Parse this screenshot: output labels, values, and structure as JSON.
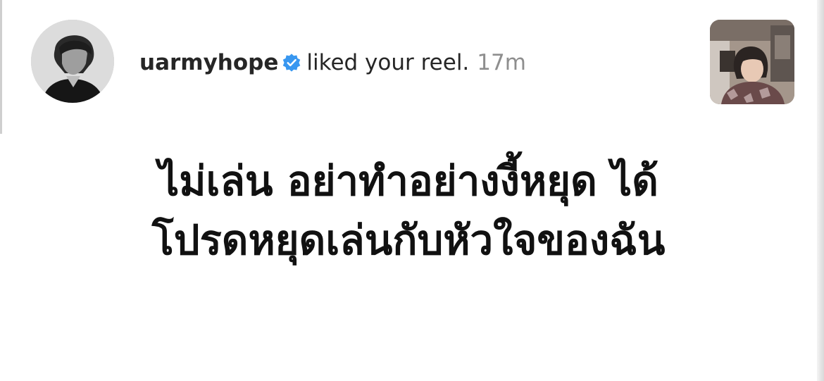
{
  "notification": {
    "username": "uarmyhope",
    "action": "liked your reel.",
    "time": "17m",
    "avatar_icon": "profile-avatar",
    "verified_icon": "verified-badge-icon",
    "verified_color": "#3897f0",
    "thumbnail": "reel-thumbnail"
  },
  "caption": {
    "line1": "ไม่เล่น อย่าทำอย่างงี้หยุด ได้",
    "line2": "โปรดหยุดเล่นกับหัวใจของฉัน"
  }
}
